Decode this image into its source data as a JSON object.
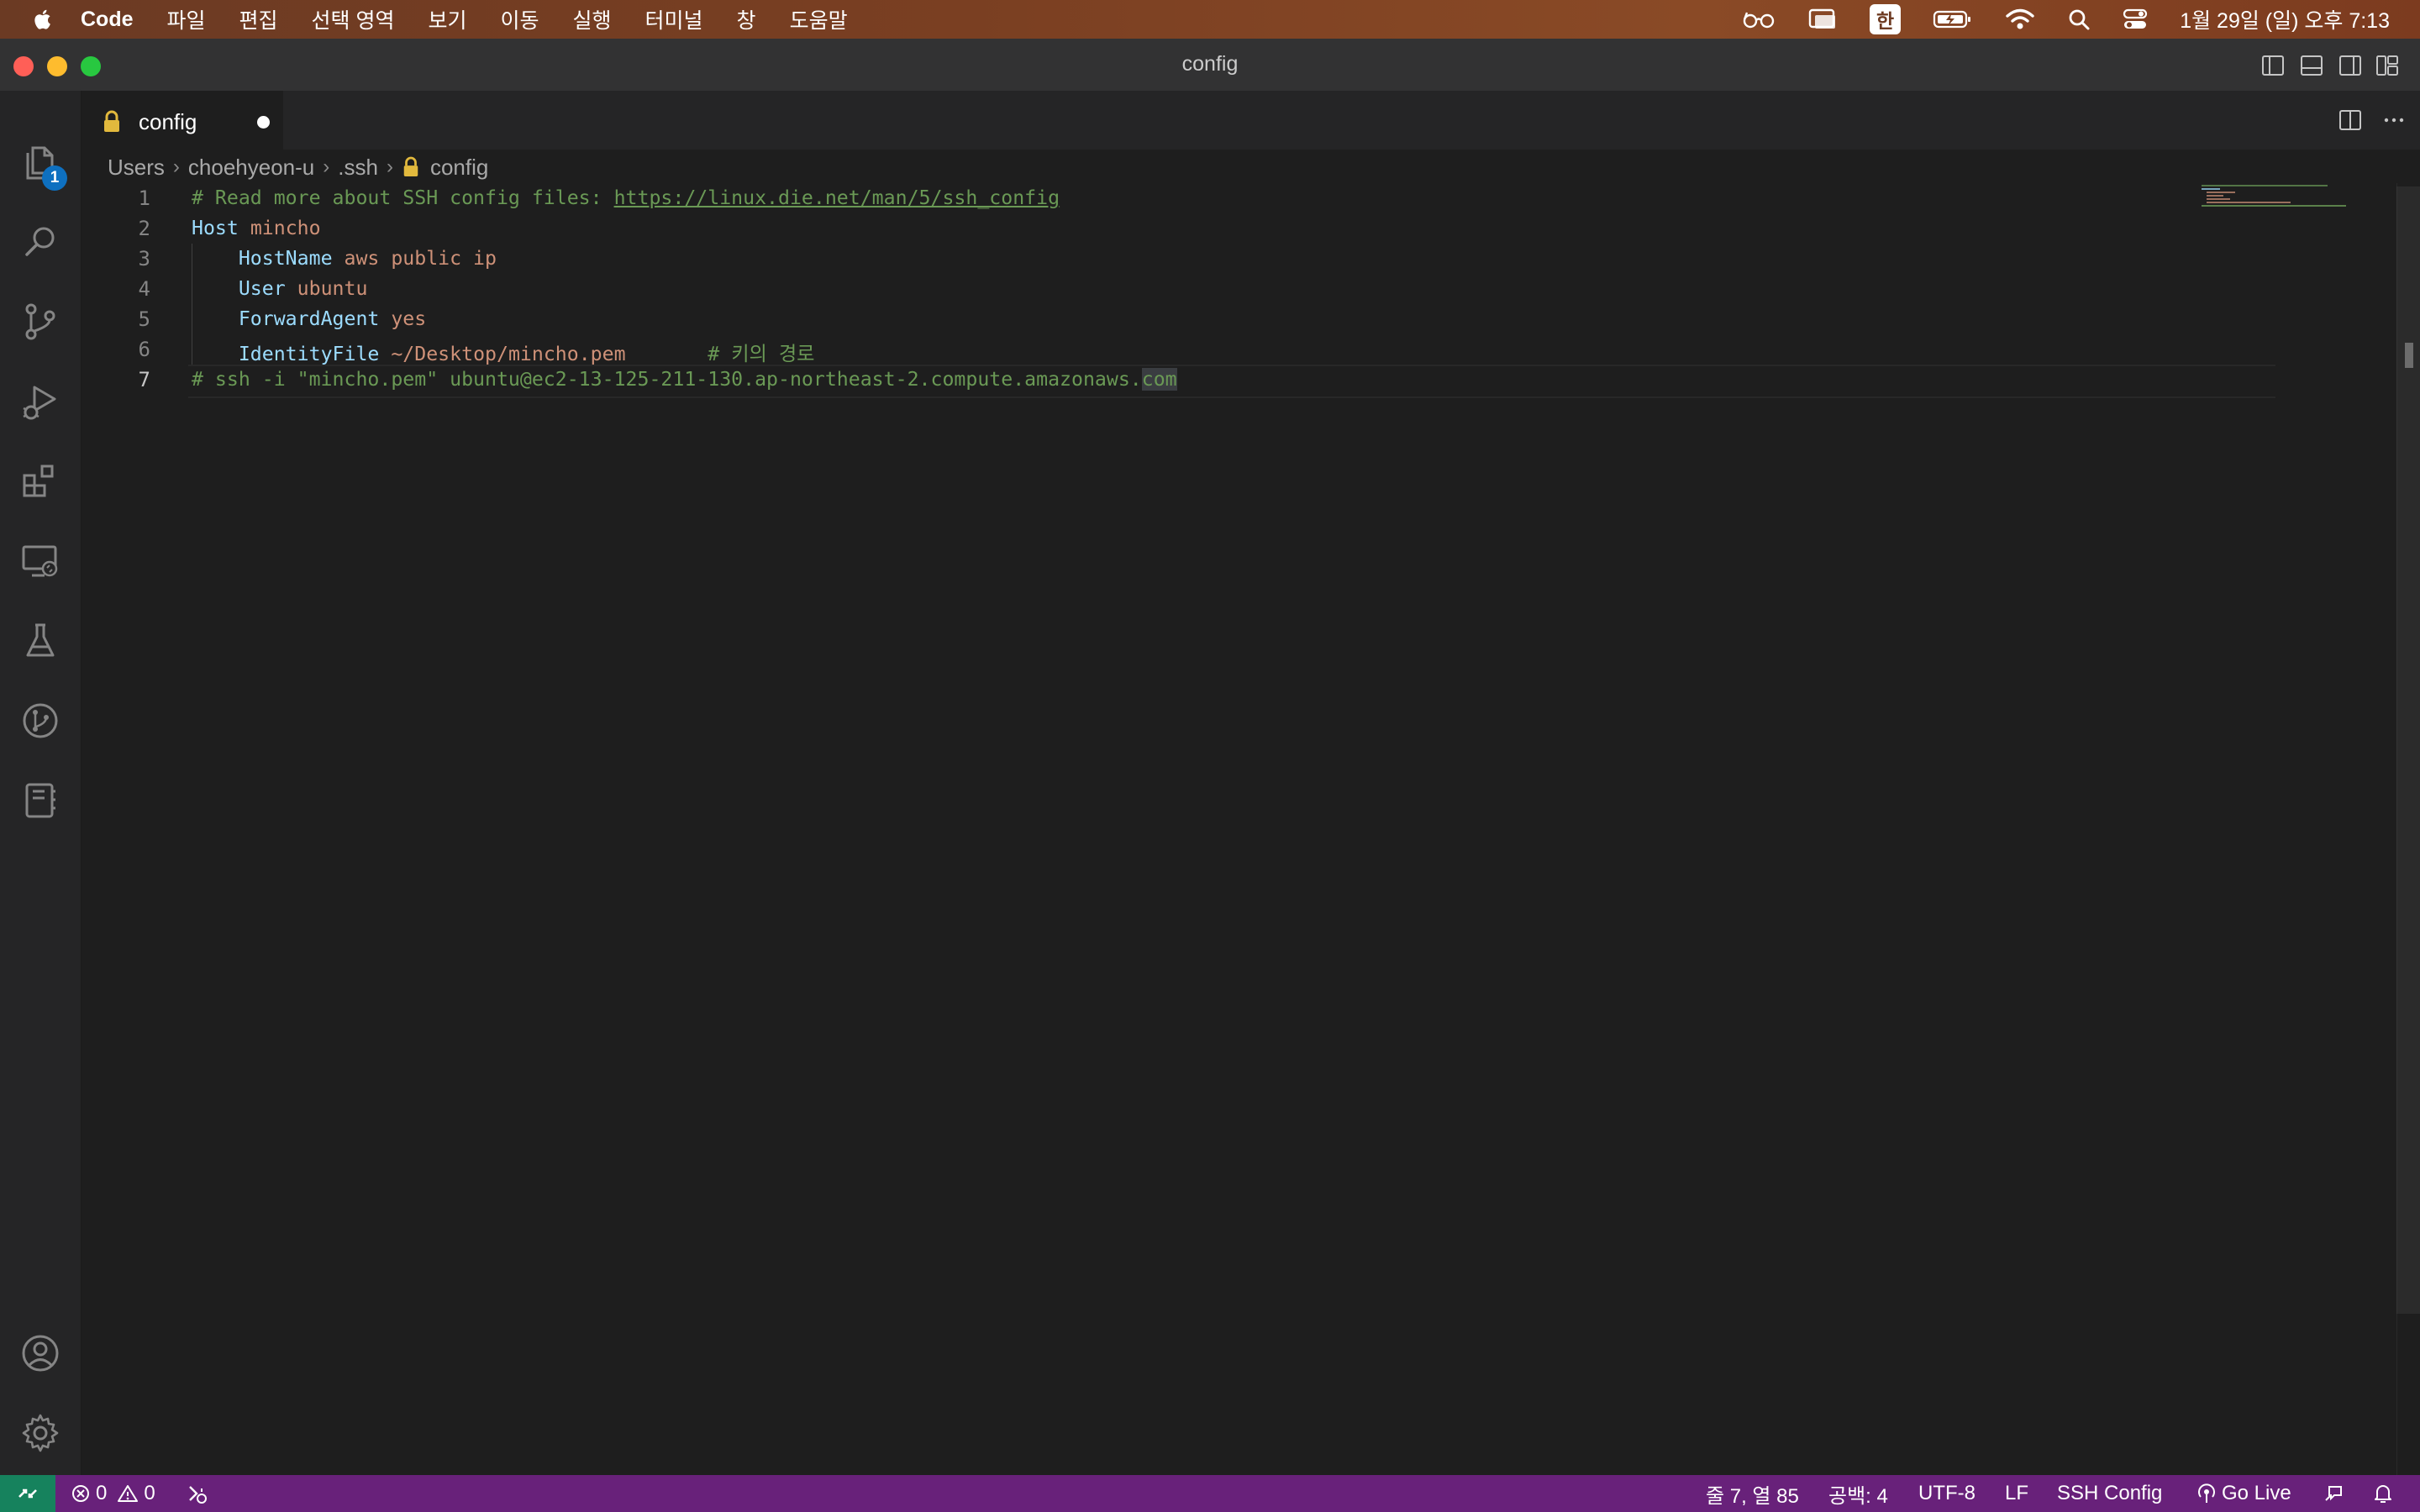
{
  "menubar": {
    "app_name": "Code",
    "items": [
      "파일",
      "편집",
      "선택 영역",
      "보기",
      "이동",
      "실행",
      "터미널",
      "창",
      "도움말"
    ],
    "ime_label": "한",
    "clock": "1월 29일 (일) 오후 7:13"
  },
  "window": {
    "title": "config"
  },
  "activity_bar": {
    "explorer_badge": "1"
  },
  "tabs": [
    {
      "label": "config",
      "dirty": true
    }
  ],
  "breadcrumb": [
    "Users",
    "choehyeon-u",
    ".ssh",
    "config"
  ],
  "editor": {
    "current_line": 7,
    "lines": [
      {
        "num": "1",
        "tokens": [
          {
            "t": "comment",
            "v": "# Read more about SSH config files: "
          },
          {
            "t": "link",
            "v": "https://linux.die.net/man/5/ssh_config"
          }
        ]
      },
      {
        "num": "2",
        "tokens": [
          {
            "t": "kw",
            "v": "Host"
          },
          {
            "t": "plain",
            "v": " "
          },
          {
            "t": "val",
            "v": "mincho"
          }
        ]
      },
      {
        "num": "3",
        "tokens": [
          {
            "t": "plain",
            "v": "    "
          },
          {
            "t": "key",
            "v": "HostName"
          },
          {
            "t": "plain",
            "v": " "
          },
          {
            "t": "val",
            "v": "aws public ip"
          }
        ]
      },
      {
        "num": "4",
        "tokens": [
          {
            "t": "plain",
            "v": "    "
          },
          {
            "t": "key",
            "v": "User"
          },
          {
            "t": "plain",
            "v": " "
          },
          {
            "t": "val",
            "v": "ubuntu"
          }
        ]
      },
      {
        "num": "5",
        "tokens": [
          {
            "t": "plain",
            "v": "    "
          },
          {
            "t": "key",
            "v": "ForwardAgent"
          },
          {
            "t": "plain",
            "v": " "
          },
          {
            "t": "val",
            "v": "yes"
          }
        ]
      },
      {
        "num": "6",
        "tokens": [
          {
            "t": "plain",
            "v": "    "
          },
          {
            "t": "key",
            "v": "IdentityFile"
          },
          {
            "t": "plain",
            "v": " "
          },
          {
            "t": "val",
            "v": "~/Desktop/mincho.pem"
          },
          {
            "t": "plain",
            "v": "       "
          },
          {
            "t": "comment",
            "v": "# 키의 경로"
          }
        ]
      },
      {
        "num": "7",
        "tokens": [
          {
            "t": "comment",
            "v": "# ssh -i \"mincho.pem\" ubuntu@ec2-13-125-211-130.ap-northeast-2.compute.amazonaws."
          },
          {
            "t": "comment_hl",
            "v": "com"
          }
        ]
      }
    ]
  },
  "statusbar": {
    "errors": "0",
    "warnings": "0",
    "position": "줄 7, 열 85",
    "indent": "공백: 4",
    "encoding": "UTF-8",
    "eol": "LF",
    "language": "SSH Config",
    "go_live": "Go Live"
  },
  "colors": {
    "statusbar_bg": "#68217a",
    "remote_bg": "#16825d",
    "comment": "#6a9955",
    "keyword": "#9cdcfe",
    "value": "#ce9178"
  }
}
